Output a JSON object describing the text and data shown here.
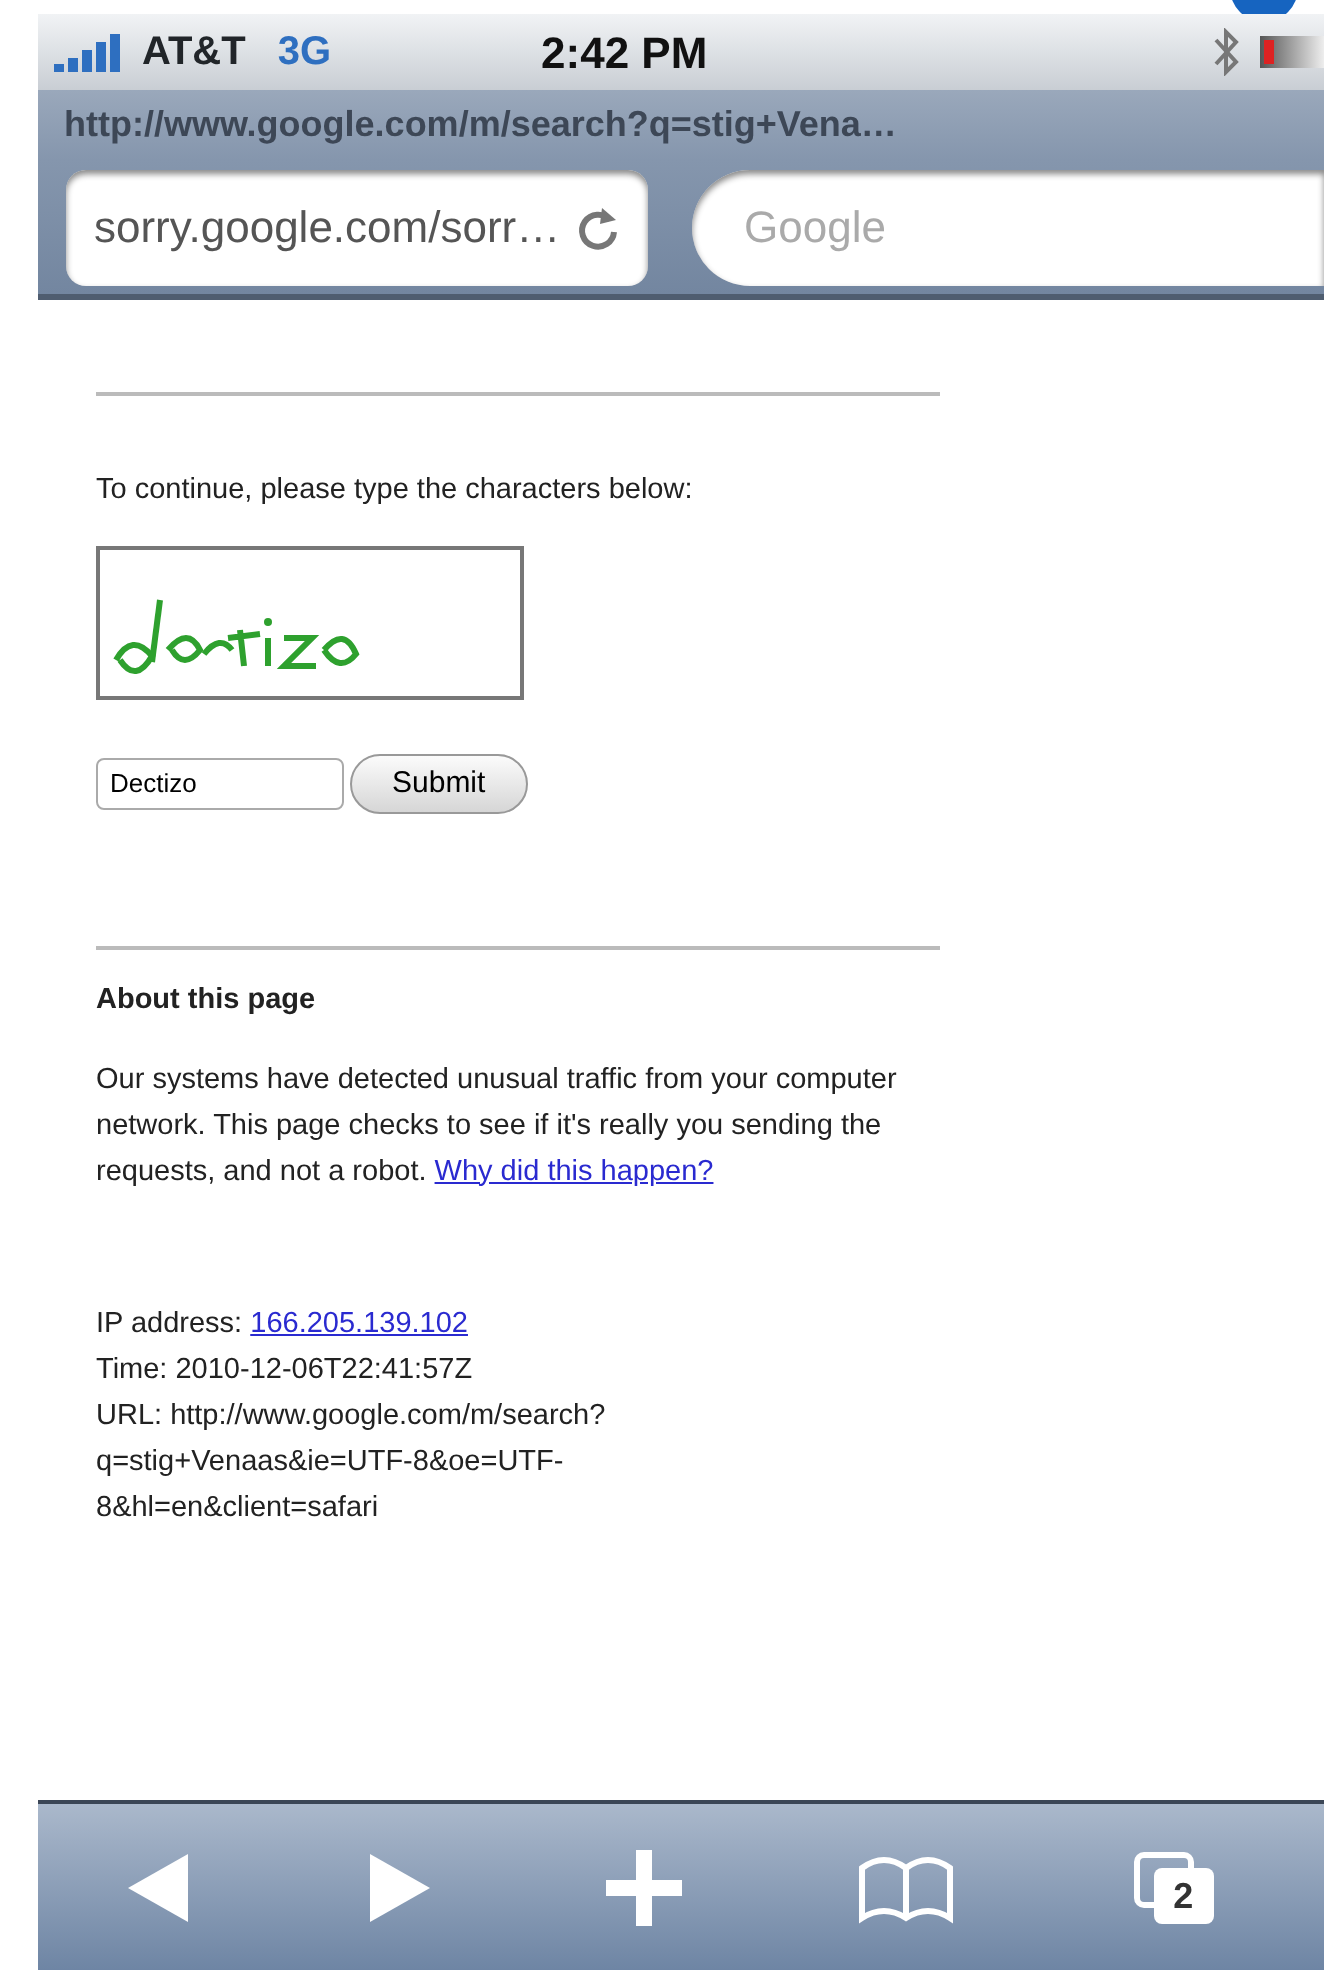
{
  "status_bar": {
    "carrier": "AT&T",
    "network": "3G",
    "time": "2:42 PM"
  },
  "title_bar": {
    "title": "http://www.google.com/m/search?q=stig+Vena…"
  },
  "address_field": {
    "value": "sorry.google.com/sorr…"
  },
  "search_field": {
    "placeholder": "Google"
  },
  "page": {
    "prompt": "To continue, please type the characters below:",
    "captcha_input": {
      "value": "Dectizo"
    },
    "submit_button": "Submit",
    "about_heading": "About this page",
    "about_text": "Our systems have detected unusual traffic from your computer network. This page checks to see if it's really you sending the requests, and not a robot.",
    "about_link": "Why did this happen?",
    "ip_label": "IP address:",
    "ip_link": "166.205.139.102",
    "time_line": "Time: 2010-12-06T22:41:57Z",
    "url_lines": [
      "URL: http://www.google.com/m/search?",
      "q=stig+Venaas&ie=UTF-8&oe=UTF-",
      "8&hl=en&client=safari"
    ]
  },
  "toolbar": {
    "tab_count": "2"
  }
}
